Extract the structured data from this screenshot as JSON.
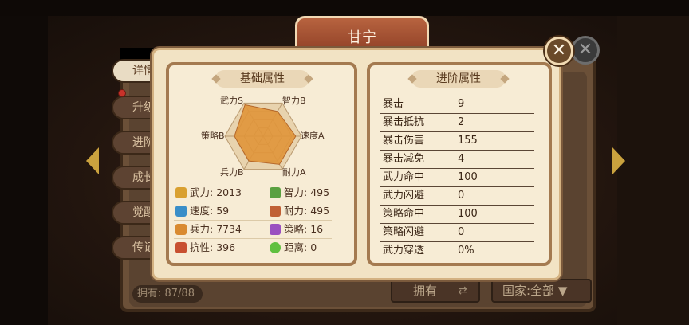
{
  "hero": {
    "name": "甘宁"
  },
  "side_tabs": [
    {
      "label": "详情"
    },
    {
      "label": "升级"
    },
    {
      "label": "进阶"
    },
    {
      "label": "成长"
    },
    {
      "label": "觉醒"
    },
    {
      "label": "传记"
    }
  ],
  "basic": {
    "title": "基础属性",
    "radar_axes": [
      "武力S",
      "智力B",
      "速度A",
      "耐力A",
      "兵力B",
      "策略B"
    ],
    "radar_values": [
      0.95,
      0.75,
      0.85,
      0.85,
      0.75,
      0.75
    ],
    "radar_fill": "#e0953a",
    "stats": [
      {
        "label": "武力:",
        "value": "2013",
        "icon": "sword-icon",
        "color": "#d9a030"
      },
      {
        "label": "智力:",
        "value": "495",
        "icon": "scroll-icon",
        "color": "#5aa040"
      },
      {
        "label": "速度:",
        "value": "59",
        "icon": "boot-icon",
        "color": "#3a8ec8"
      },
      {
        "label": "耐力:",
        "value": "495",
        "icon": "horse-icon",
        "color": "#c06035"
      },
      {
        "label": "兵力:",
        "value": "7734",
        "icon": "helmet-icon",
        "color": "#d98a30"
      },
      {
        "label": "策略:",
        "value": "16",
        "icon": "book-icon",
        "color": "#9a50c0"
      },
      {
        "label": "抗性:",
        "value": "396",
        "icon": "shield-icon",
        "color": "#c85030"
      },
      {
        "label": "距离:",
        "value": "0",
        "icon": "target-icon",
        "color": "#60c040"
      }
    ]
  },
  "advanced": {
    "title": "进阶属性",
    "rows": [
      {
        "name": "暴击",
        "value": "9"
      },
      {
        "name": "暴击抵抗",
        "value": "2"
      },
      {
        "name": "暴击伤害",
        "value": "155"
      },
      {
        "name": "暴击减免",
        "value": "4"
      },
      {
        "name": "武力命中",
        "value": "100"
      },
      {
        "name": "武力闪避",
        "value": "0"
      },
      {
        "name": "策略命中",
        "value": "100"
      },
      {
        "name": "策略闪避",
        "value": "0"
      },
      {
        "name": "武力穿透",
        "value": "0%"
      }
    ]
  },
  "footer": {
    "count": "拥有: 87/88",
    "own_button": "拥有",
    "country_select": "国家:全部"
  },
  "icons": {
    "close": "close-icon",
    "swap": "swap-icon",
    "dropdown": "triangle-down-icon"
  }
}
